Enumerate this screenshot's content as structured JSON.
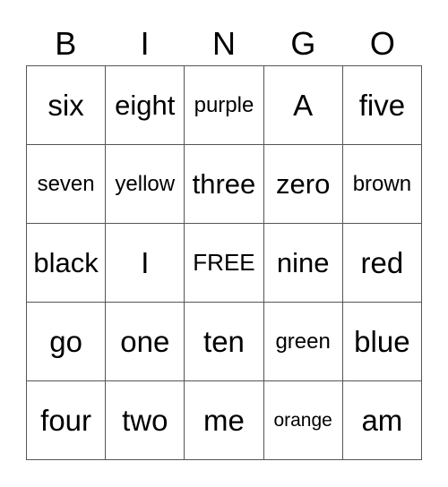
{
  "header": [
    "B",
    "I",
    "N",
    "G",
    "O"
  ],
  "rows": [
    [
      "six",
      "eight",
      "purple",
      "A",
      "five"
    ],
    [
      "seven",
      "yellow",
      "three",
      "zero",
      "brown"
    ],
    [
      "black",
      "I",
      "FREE",
      "nine",
      "red"
    ],
    [
      "go",
      "one",
      "ten",
      "green",
      "blue"
    ],
    [
      "four",
      "two",
      "me",
      "orange",
      "am"
    ]
  ],
  "sizes": [
    [
      "s-xl",
      "s-l",
      "s-s",
      "s-xl",
      "s-xl"
    ],
    [
      "s-s",
      "s-s",
      "s-l",
      "s-l",
      "s-s"
    ],
    [
      "s-l",
      "s-xl",
      "s-m",
      "s-l",
      "s-xl"
    ],
    [
      "s-xl",
      "s-xl",
      "s-xl",
      "s-s",
      "s-xl"
    ],
    [
      "s-xl",
      "s-xl",
      "s-xl",
      "s-xs",
      "s-xl"
    ]
  ]
}
